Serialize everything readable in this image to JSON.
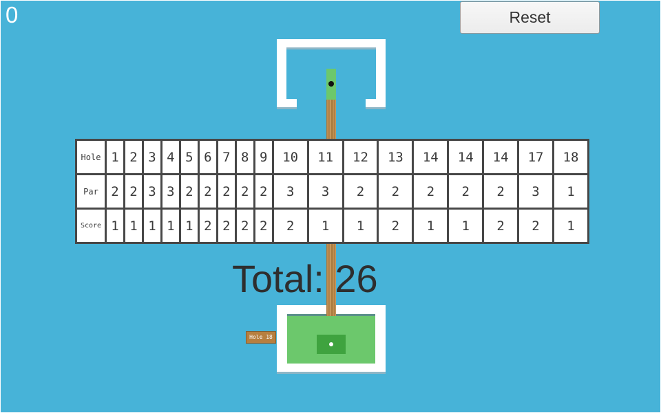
{
  "hud": {
    "stroke_count": "0",
    "reset_label": "Reset"
  },
  "scorecard": {
    "row_labels": {
      "hole": "Hole",
      "par": "Par",
      "score": "Score"
    },
    "holes": [
      "1",
      "2",
      "3",
      "4",
      "5",
      "6",
      "7",
      "8",
      "9",
      "10",
      "11",
      "12",
      "13",
      "14",
      "14",
      "14",
      "17",
      "18"
    ],
    "par": [
      "2",
      "2",
      "3",
      "3",
      "2",
      "2",
      "2",
      "2",
      "2",
      "3",
      "3",
      "2",
      "2",
      "2",
      "2",
      "2",
      "3",
      "1"
    ],
    "score": [
      "1",
      "1",
      "1",
      "1",
      "1",
      "2",
      "2",
      "2",
      "2",
      "2",
      "1",
      "1",
      "2",
      "1",
      "1",
      "2",
      "2",
      "1"
    ]
  },
  "total": {
    "label": "Total: 26"
  },
  "course": {
    "hole_sign": "Hole 18"
  },
  "colors": {
    "background": "#47b3d8",
    "green": "#6cc86c",
    "dark_green": "#3fa33f",
    "wall": "#ffffff",
    "plank": "#b07c3e"
  }
}
